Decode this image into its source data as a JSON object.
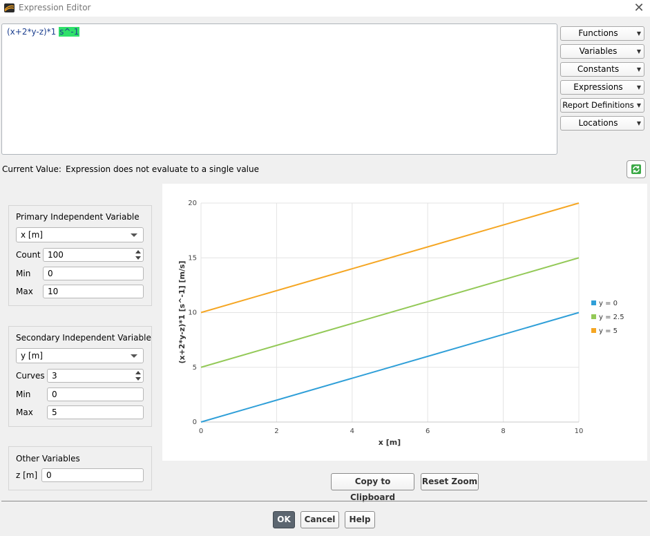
{
  "window": {
    "title": "Expression Editor",
    "close_glyph": "✕"
  },
  "editor": {
    "expression": "(x+2*y-z)*1 ",
    "unit": "s^-1"
  },
  "menus": [
    {
      "label": "Functions"
    },
    {
      "label": "Variables"
    },
    {
      "label": "Constants"
    },
    {
      "label": "Expressions"
    },
    {
      "label": "Report Definitions"
    },
    {
      "label": "Locations"
    }
  ],
  "current_value": {
    "label": "Current Value:",
    "value": "Expression does not evaluate to a single value",
    "refresh_icon": "refresh-icon"
  },
  "primary": {
    "title": "Primary Independent Variable",
    "variable": "x [m]",
    "count_label": "Count",
    "count": "100",
    "min_label": "Min",
    "min": "0",
    "max_label": "Max",
    "max": "10"
  },
  "secondary": {
    "title": "Secondary Independent Variable",
    "variable": "y [m]",
    "curves_label": "Curves",
    "curves": "3",
    "min_label": "Min",
    "min": "0",
    "max_label": "Max",
    "max": "5"
  },
  "other": {
    "title": "Other Variables",
    "z_label": "z [m]",
    "z": "0"
  },
  "chart_buttons": {
    "copy": "Copy to Clipboard",
    "reset": "Reset Zoom"
  },
  "dialog_buttons": {
    "ok": "OK",
    "cancel": "Cancel",
    "help": "Help"
  },
  "chart_data": {
    "type": "line",
    "xlabel": "x [m]",
    "ylabel": "(x+2*y-z)*1 [s^-1] [m/s]",
    "xlim": [
      0,
      10
    ],
    "ylim": [
      0,
      20
    ],
    "xticks": [
      0,
      2,
      4,
      6,
      8,
      10
    ],
    "yticks": [
      0,
      5,
      10,
      15,
      20
    ],
    "grid": true,
    "legend_position": "right",
    "series": [
      {
        "name": "y = 0",
        "color": "#2f9fd8",
        "x": [
          0,
          10
        ],
        "y": [
          0,
          10
        ]
      },
      {
        "name": "y = 2.5",
        "color": "#93c957",
        "x": [
          0,
          10
        ],
        "y": [
          5,
          15
        ]
      },
      {
        "name": "y = 5",
        "color": "#f5a623",
        "x": [
          0,
          10
        ],
        "y": [
          10,
          20
        ]
      }
    ]
  }
}
